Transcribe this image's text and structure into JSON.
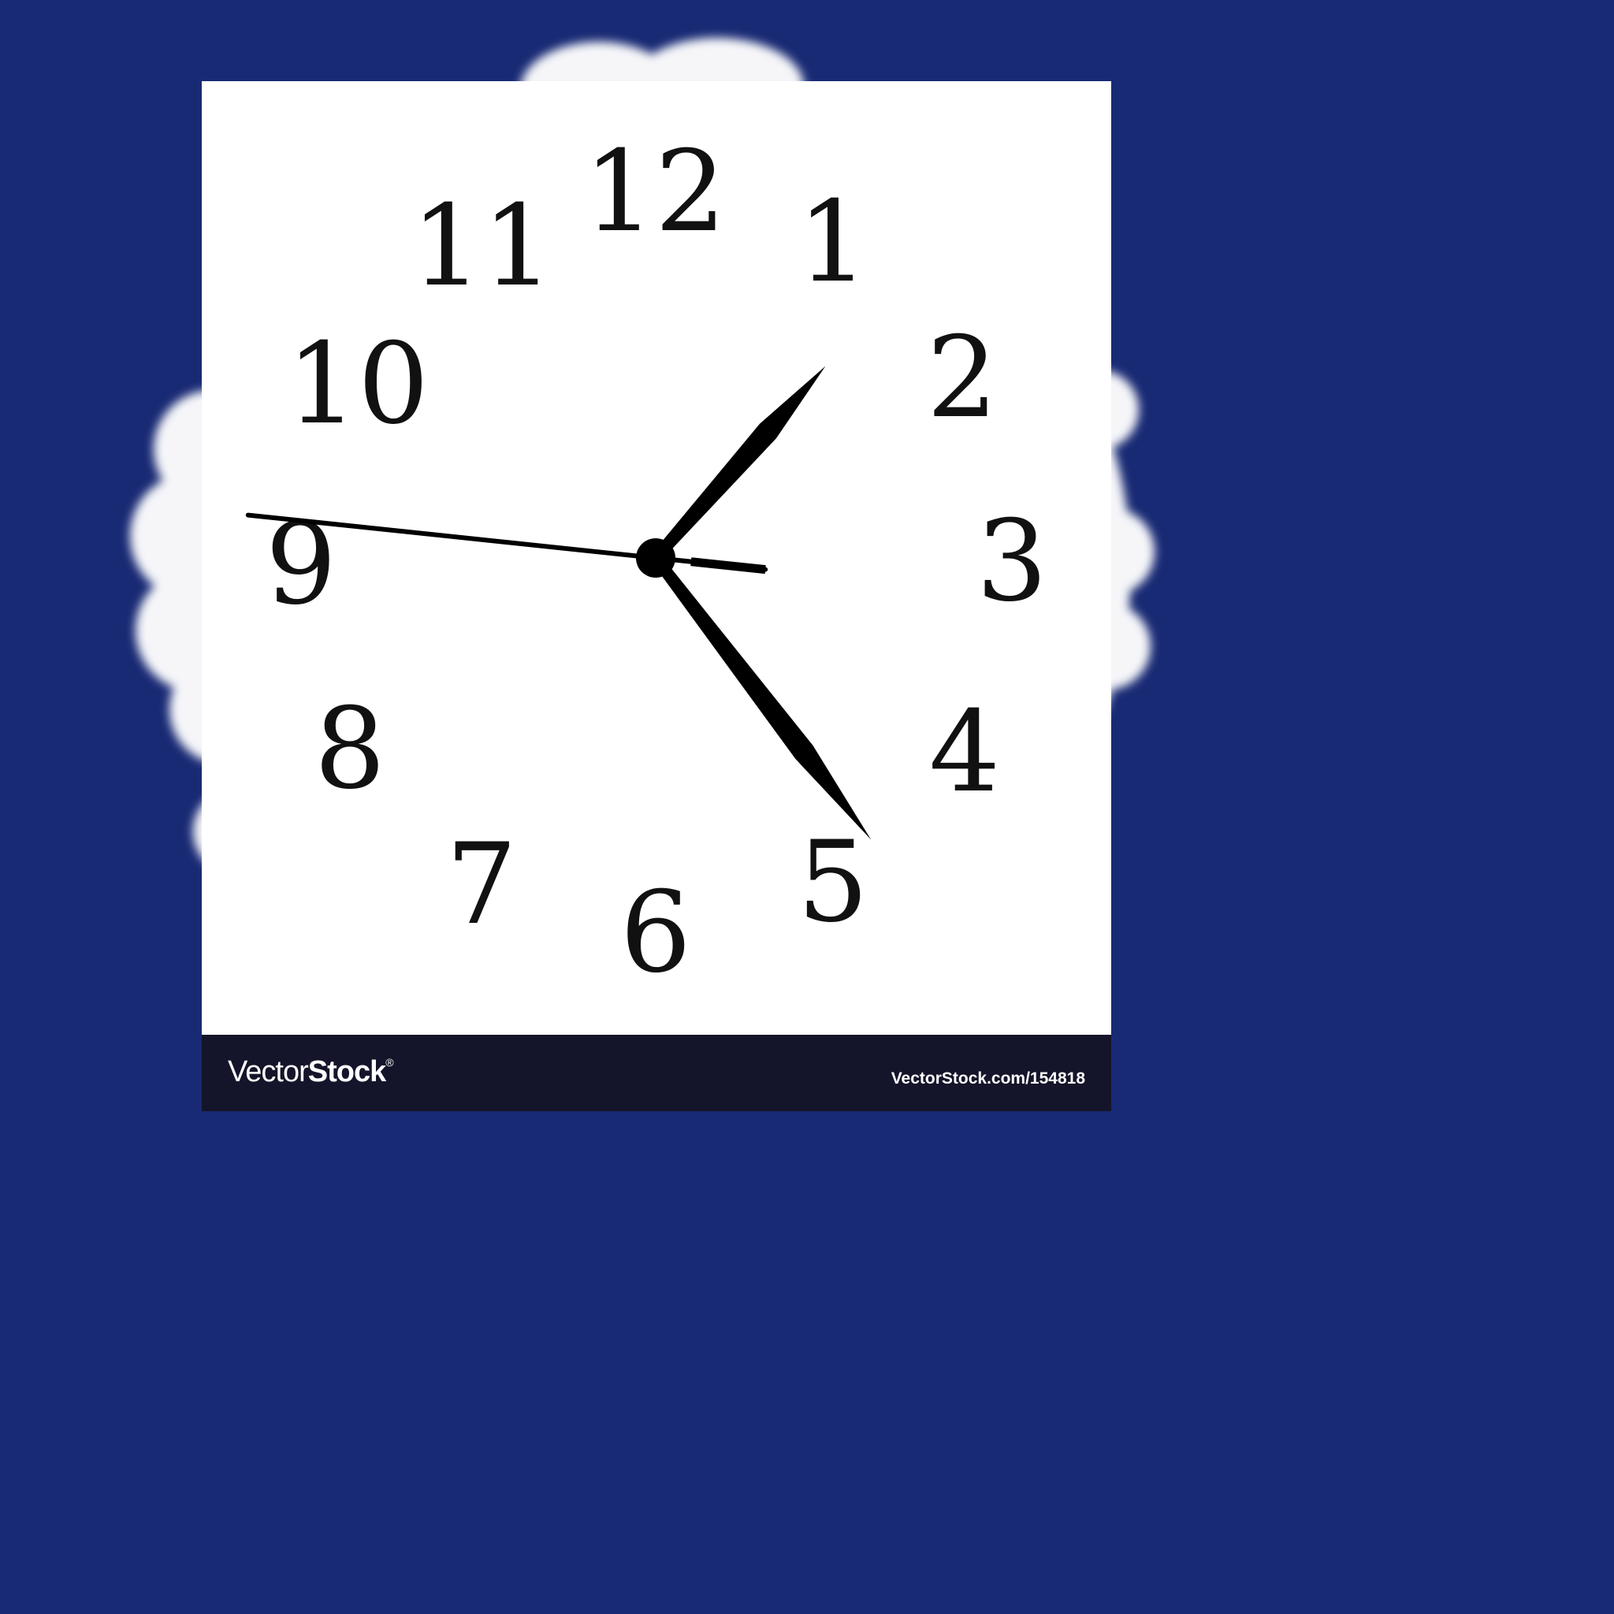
{
  "clock": {
    "numerals": [
      "12",
      "1",
      "2",
      "3",
      "4",
      "5",
      "6",
      "7",
      "8",
      "9",
      "10",
      "11"
    ],
    "time_shown": {
      "hour": 1,
      "minute": 23,
      "second": 46
    }
  },
  "footer": {
    "brand_light": "Vector",
    "brand_bold": "Stock",
    "brand_mark": "®",
    "url": "VectorStock.com/154818"
  },
  "colors": {
    "background": "#192a74",
    "panel": "#ffffff",
    "footer": "#14152a",
    "hands": "#000000"
  }
}
